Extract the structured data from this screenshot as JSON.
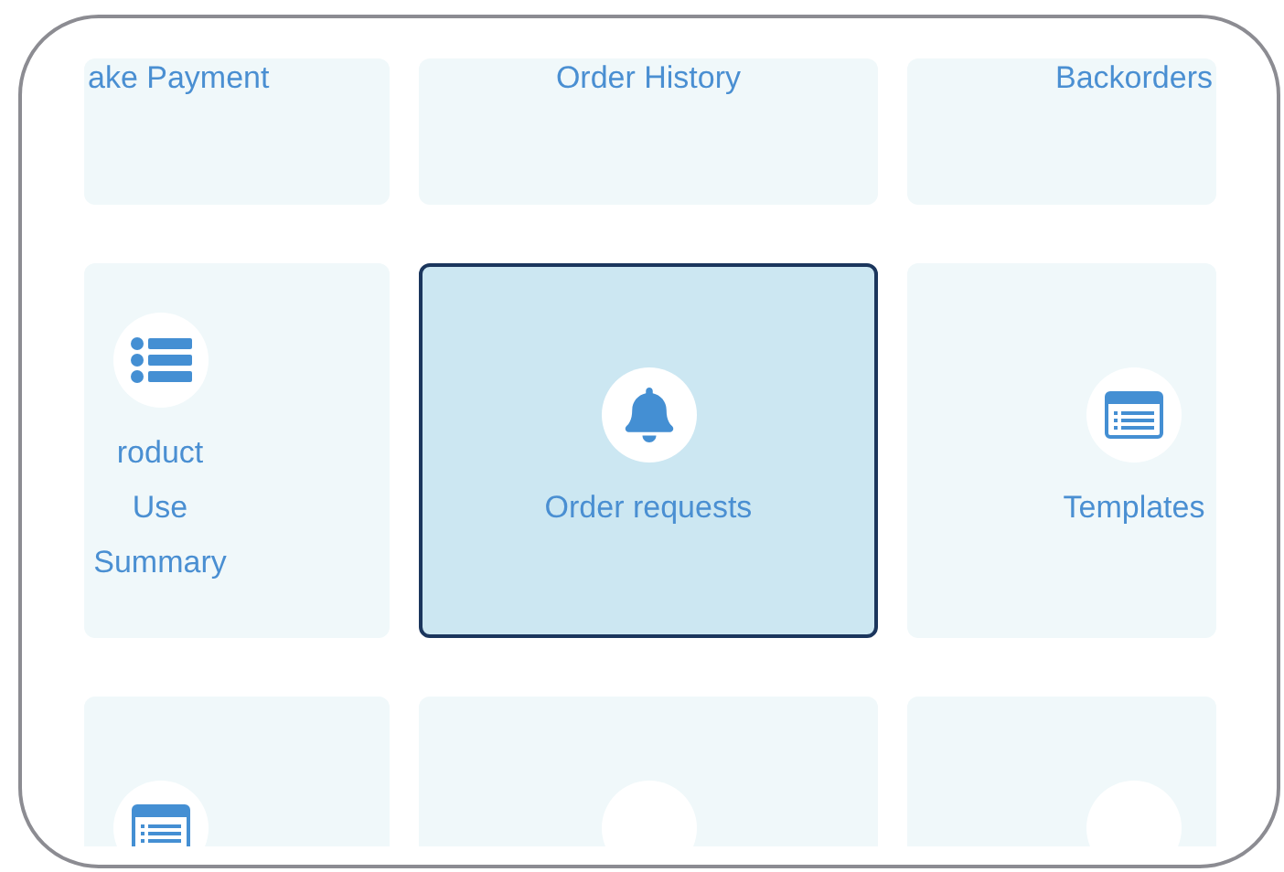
{
  "rows": [
    {
      "tiles": [
        {
          "label": "ake Payment",
          "kind": "text",
          "selected": false
        },
        {
          "label": "Order History",
          "kind": "text",
          "selected": false
        },
        {
          "label": "Backorders",
          "kind": "text",
          "selected": false
        }
      ]
    },
    {
      "tiles": [
        {
          "label": "roduct Use Summary",
          "kind": "list",
          "selected": false
        },
        {
          "label": "Order requests",
          "kind": "bell",
          "selected": true
        },
        {
          "label": "Templates",
          "kind": "window",
          "selected": false
        }
      ]
    },
    {
      "tiles": [
        {
          "kind": "window",
          "selected": false
        },
        {
          "kind": "blank",
          "selected": false
        },
        {
          "kind": "blank",
          "selected": false
        }
      ]
    }
  ]
}
